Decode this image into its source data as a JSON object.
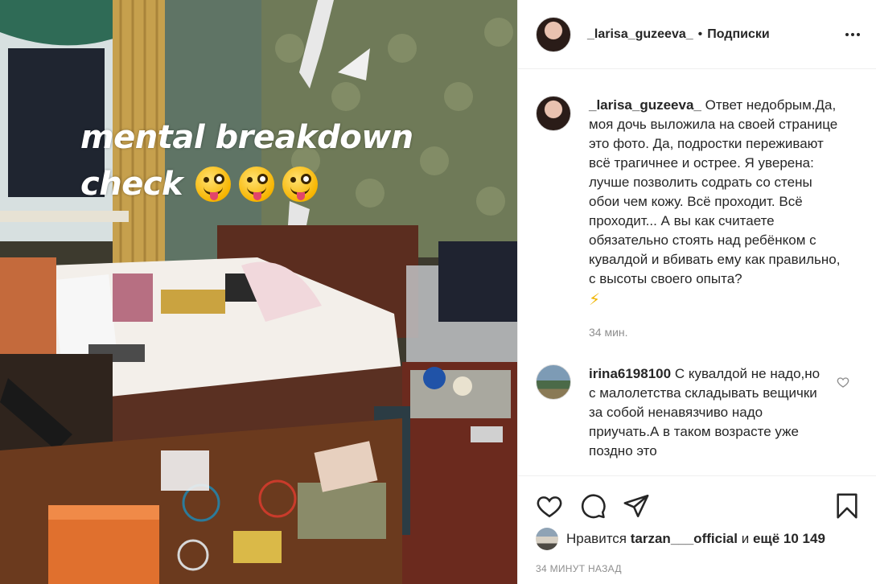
{
  "photo": {
    "overlay_line1": "mental breakdown",
    "overlay_line2": "check"
  },
  "header": {
    "username": "_larisa_guzeeva_",
    "separator": "•",
    "follow_label": "Подписки"
  },
  "caption": {
    "username": "_larisa_guzeeva_",
    "text": "Ответ недобрым.Да, моя дочь выложила на своей странице это фото. Да, подростки переживают всё трагичнее и острее. Я уверена: лучше позволить содрать со стены обои чем кожу. Всё проходит. Всё проходит... А вы как считаете обязательно стоять над ребёнком с кувалдой и вбивать ему как правильно, с высоты своего опыта?",
    "emoji": "⚡",
    "time": "34 мин."
  },
  "reply": {
    "username": "irina6198100",
    "text": "С кувалдой не надо,но с малолетства складывать вещички за собой ненавязчиво надо приучать.А в таком возрасте уже поздно это"
  },
  "likes": {
    "prefix": "Нравится",
    "user": "tarzan___official",
    "middle": "и",
    "others": "ещё 10 149"
  },
  "timestamp": "34 МИНУТ НАЗАД",
  "icons": {
    "like": "heart-icon",
    "comment": "comment-icon",
    "share": "share-icon",
    "save": "bookmark-icon",
    "more": "more-icon"
  }
}
